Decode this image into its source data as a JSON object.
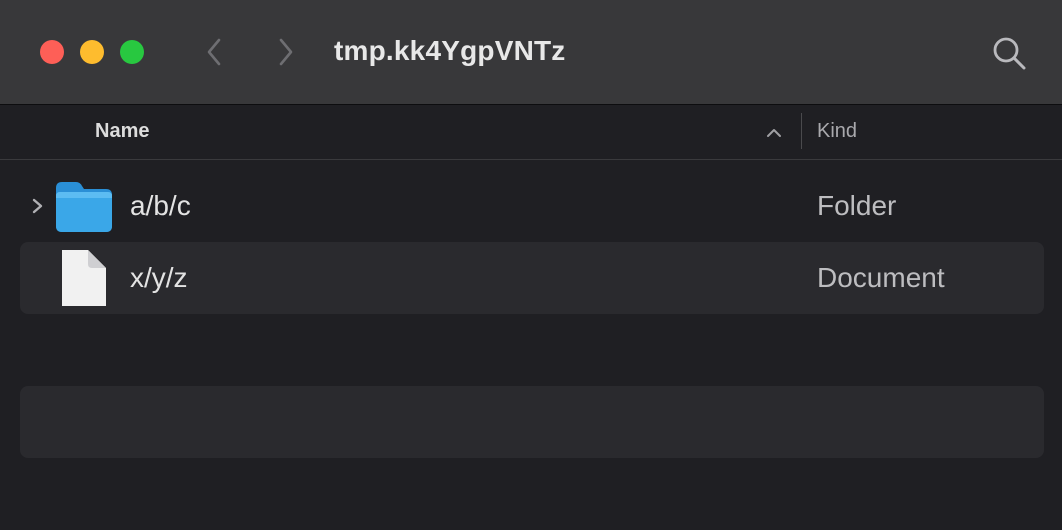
{
  "window": {
    "title": "tmp.kk4YgpVNTz",
    "controls": {
      "close_color": "#fe5f57",
      "minimize_color": "#febc2e",
      "zoom_color": "#28c840"
    },
    "toolbar": {
      "back_icon": "chevron-left-icon",
      "forward_icon": "chevron-right-icon",
      "search_icon": "search-icon"
    }
  },
  "columns": {
    "name": "Name",
    "kind": "Kind",
    "sort": "ascending"
  },
  "rows": [
    {
      "name": "a/b/c",
      "kind": "Folder",
      "icon": "folder-icon",
      "expandable": true
    },
    {
      "name": "x/y/z",
      "kind": "Document",
      "icon": "document-icon",
      "expandable": false
    }
  ],
  "colors": {
    "titlebar_bg": "#38383a",
    "content_bg": "#1f1f23",
    "stripe_bg": "#2a2a2e",
    "folder_blue": "#3aa7e8"
  }
}
